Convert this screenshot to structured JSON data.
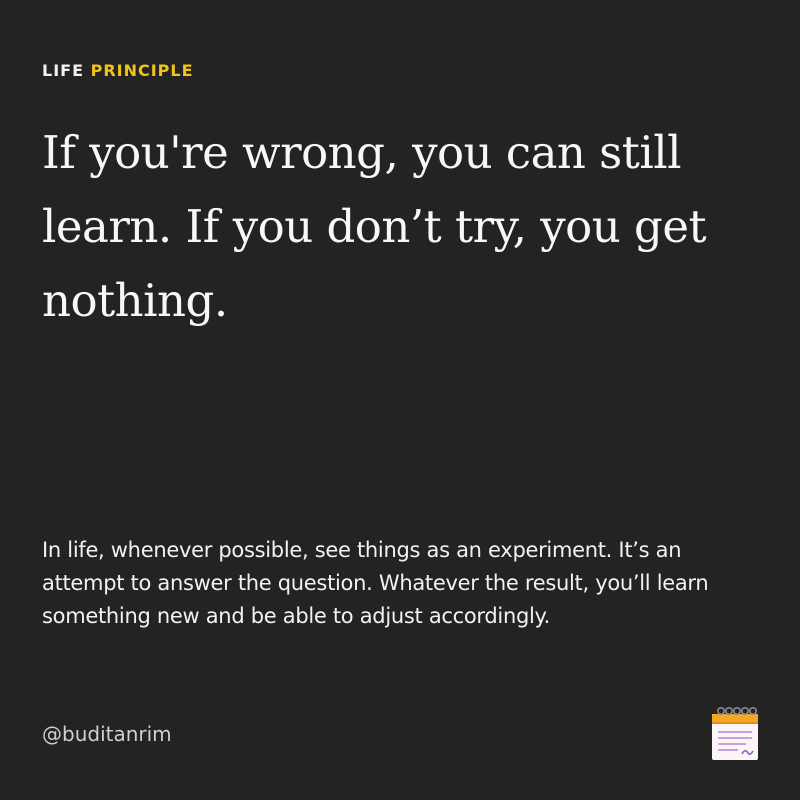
{
  "label": {
    "part1": "LIFE",
    "part2": "PRINCIPLE",
    "accent_color": "#f0c419"
  },
  "headline": "If you're wrong, you can still learn. If you don’t try, you get nothing.",
  "body": "In life, whenever possible, see things as an experiment. It’s an attempt to answer the question. Whatever the result, you’ll learn something new and be able to adjust accordingly.",
  "handle": "@buditanrim",
  "icon": "notepad-icon",
  "colors": {
    "background": "#232323",
    "text": "#f7f7f7"
  }
}
